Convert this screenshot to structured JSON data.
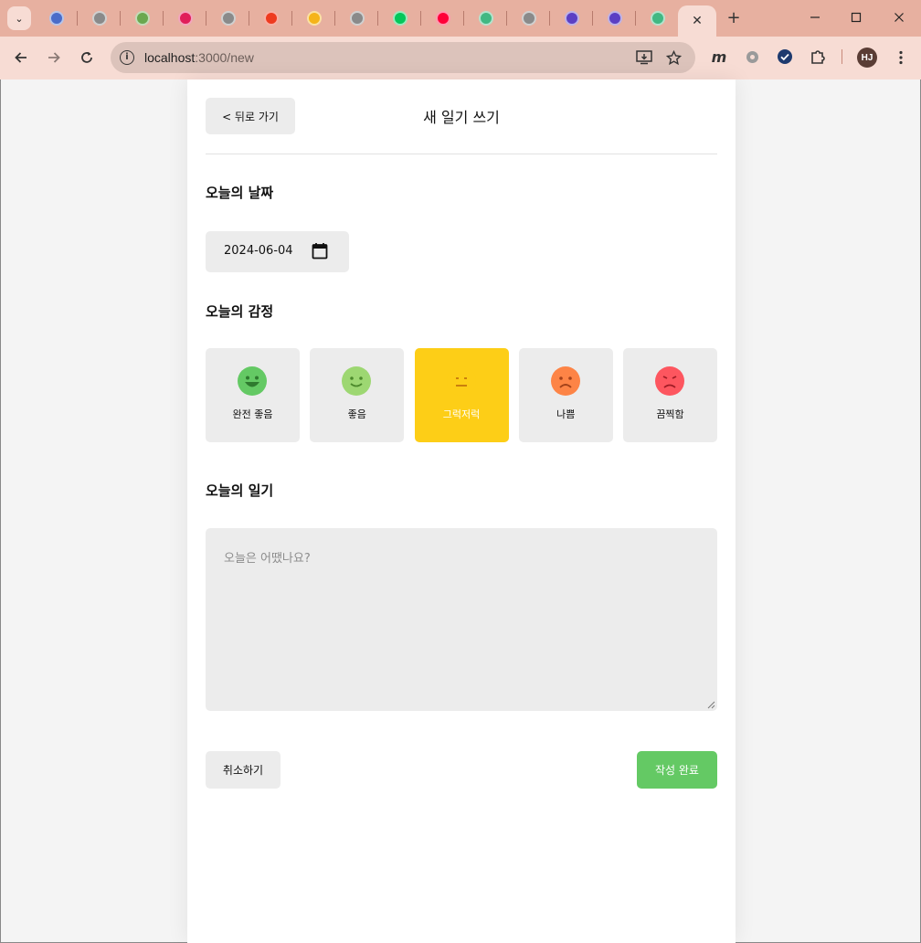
{
  "browser": {
    "tabs": [
      {
        "icon": "blue-circle-favicon",
        "color": "#4a6cc9"
      },
      {
        "icon": "gray-circle-favicon",
        "color": "#8a8a8a"
      },
      {
        "icon": "green-circle-favicon",
        "color": "#6aa84f"
      },
      {
        "icon": "slack-favicon",
        "color": "#e01e5a"
      },
      {
        "icon": "gray-circle-favicon",
        "color": "#8a8a8a"
      },
      {
        "icon": "red-square-favicon",
        "color": "#ee3b1f"
      },
      {
        "icon": "k-favicon",
        "color": "#f5b41a"
      },
      {
        "icon": "gray-circle-favicon",
        "color": "#8a8a8a"
      },
      {
        "icon": "naver-favicon",
        "color": "#03c75a"
      },
      {
        "icon": "11st-favicon",
        "color": "#ff0038"
      },
      {
        "icon": "vue-favicon",
        "color": "#41b883"
      },
      {
        "icon": "gray-circle-favicon",
        "color": "#8a8a8a"
      },
      {
        "icon": "purple-circle-favicon",
        "color": "#5b3fc4"
      },
      {
        "icon": "purple-circle-favicon",
        "color": "#5b3fc4"
      },
      {
        "icon": "vue-favicon",
        "color": "#41b883"
      }
    ],
    "active_tab_close": "✕",
    "new_tab": "+",
    "url_host": "localhost",
    "url_path": ":3000/new",
    "profile_initials": "HJ"
  },
  "header": {
    "back_label": "< 뒤로 가기",
    "title": "새 일기 쓰기"
  },
  "date_section": {
    "title": "오늘의 날짜",
    "value": "2024-06-04"
  },
  "emotion_section": {
    "title": "오늘의 감정",
    "selected": 3,
    "items": [
      {
        "label": "완전 좋음",
        "color": "#64c964",
        "mood": "very-good"
      },
      {
        "label": "좋음",
        "color": "#9dd772",
        "mood": "good"
      },
      {
        "label": "그럭저럭",
        "color": "#fdce17",
        "mood": "so-so"
      },
      {
        "label": "나쁨",
        "color": "#fd8446",
        "mood": "bad"
      },
      {
        "label": "끔찍함",
        "color": "#fd565f",
        "mood": "terrible"
      }
    ]
  },
  "diary_section": {
    "title": "오늘의 일기",
    "placeholder": "오늘은 어땠나요?",
    "value": ""
  },
  "footer": {
    "cancel_label": "취소하기",
    "submit_label": "작성 완료",
    "submit_color": "#64c964"
  }
}
